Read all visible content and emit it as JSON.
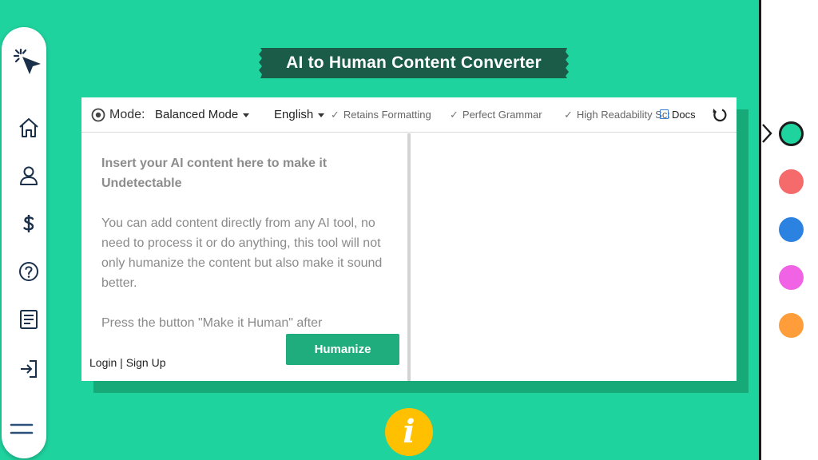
{
  "title": "AI to Human Content Converter",
  "toolbar": {
    "mode_label": "Mode:",
    "mode_value": "Balanced Mode",
    "language": "English",
    "features": [
      "Retains Formatting",
      "Perfect Grammar",
      "High Readability Score"
    ],
    "docs_label": "Docs"
  },
  "input_pane": {
    "heading": "Insert your AI content here to make it Undetectable",
    "paragraph1": "You can add content directly from any AI tool, no need to process it or do anything, this tool will not only humanize the content but also make it sound better.",
    "paragraph2": "Press the button \"Make it Human\" after"
  },
  "auth": {
    "login": "Login",
    "separator": "|",
    "signup": "Sign Up"
  },
  "humanize_button": "Humanize",
  "info_glyph": "i",
  "sidebar_icons": [
    "cursor-click-icon",
    "home-icon",
    "user-icon",
    "dollar-icon",
    "help-icon",
    "document-icon",
    "login-icon",
    "menu-icon"
  ],
  "theme_colors": [
    "#1fd39f",
    "#f56a6a",
    "#2b82e0",
    "#ef63e4",
    "#ff9d3b"
  ],
  "accent": "#20ad7d",
  "title_bg": "#1a5c47"
}
